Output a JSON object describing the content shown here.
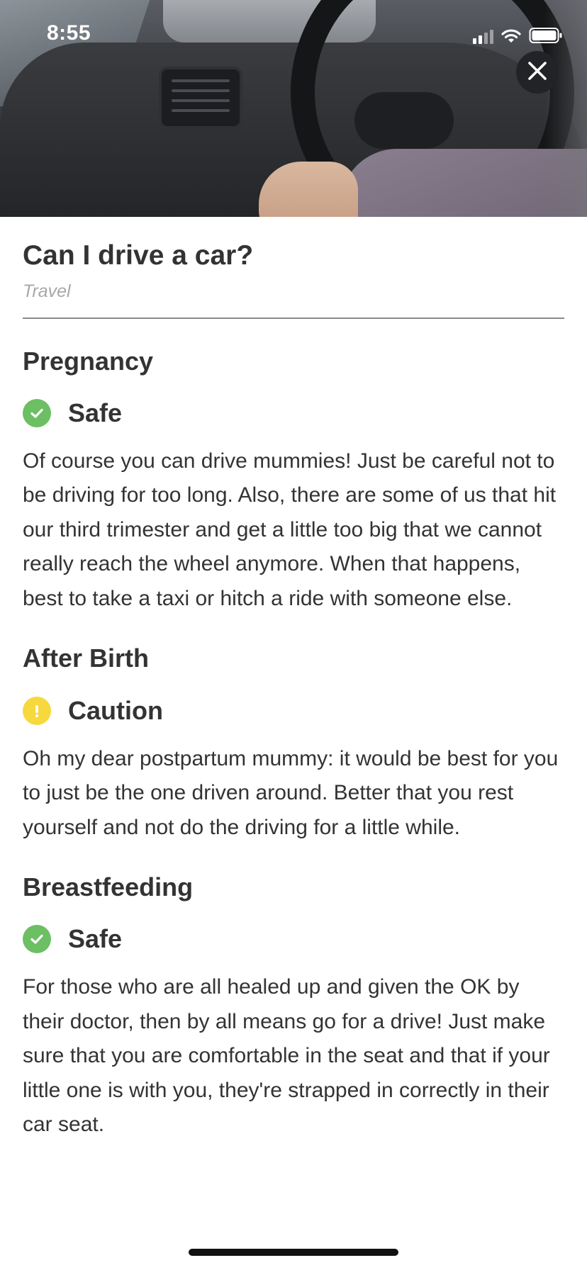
{
  "status_bar": {
    "time": "8:55"
  },
  "header": {
    "title": "Can I drive a car?",
    "category": "Travel"
  },
  "colors": {
    "safe": "#6cbf63",
    "caution": "#f7d83d",
    "text": "#333333",
    "category": "#a8a8a8"
  },
  "sections": [
    {
      "heading": "Pregnancy",
      "status": "Safe",
      "status_icon": "check-circle-icon",
      "body": "Of course you can drive mummies! Just be careful not to be driving for too long. Also, there are some of us that hit our third trimester and get a little too big that we cannot really reach the wheel anymore. When that happens, best to take a taxi or hitch a ride with someone else."
    },
    {
      "heading": "After Birth",
      "status": "Caution",
      "status_icon": "exclamation-circle-icon",
      "body": "Oh my dear postpartum mummy: it would be best for you to just be the one driven around. Better that you rest yourself and not do the driving for a little while."
    },
    {
      "heading": "Breastfeeding",
      "status": "Safe",
      "status_icon": "check-circle-icon",
      "body": "For those who are all healed up and given the OK by their doctor, then by all means go for a drive!  Just make sure that you are comfortable in the seat and that if your little one is with you, they're strapped in correctly in their car seat."
    }
  ]
}
